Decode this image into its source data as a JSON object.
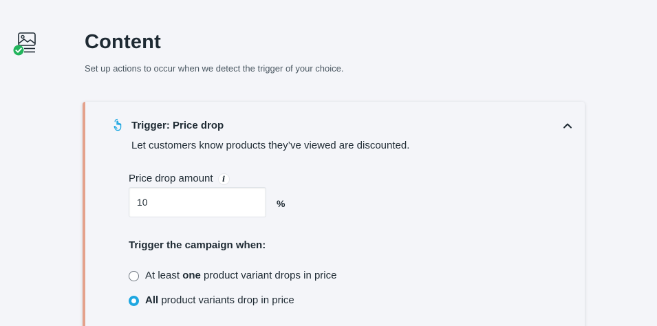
{
  "header": {
    "step_icon": "image-content-icon",
    "step_status_icon": "check-circle-icon",
    "title": "Content",
    "subtitle": "Set up actions to occur when we detect the trigger of your choice."
  },
  "trigger_card": {
    "icon": "hand-pointer-icon",
    "title": "Trigger: Price drop",
    "description": "Let customers know products they’ve viewed are discounted.",
    "collapse_icon": "chevron-up-icon",
    "accent_color": "#e4a18b",
    "price_drop": {
      "label": "Price drop amount",
      "info_icon": "info-icon",
      "value": "10",
      "unit": "%"
    },
    "campaign_condition": {
      "heading": "Trigger the campaign when:",
      "options": [
        {
          "prefix": "At least ",
          "emphasis": "one",
          "suffix": " product variant drops in price",
          "selected": false
        },
        {
          "prefix": "",
          "emphasis": "All",
          "suffix": " product variants drop in price",
          "selected": true
        }
      ]
    }
  },
  "colors": {
    "background": "#f4f5f9",
    "text": "#1e2a33",
    "success": "#22b45c",
    "radio_selected": "#1ea7e1",
    "trigger_icon": "#1ea7e1"
  }
}
